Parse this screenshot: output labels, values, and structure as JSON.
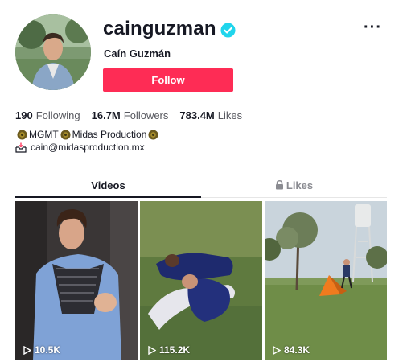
{
  "profile": {
    "username": "cainguzman",
    "display_name": "Caín Guzmán",
    "verified": true,
    "follow_label": "Follow",
    "more_label": "···"
  },
  "stats": [
    {
      "value": "190",
      "label": "Following"
    },
    {
      "value": "16.7M",
      "label": "Followers"
    },
    {
      "value": "783.4M",
      "label": "Likes"
    }
  ],
  "bio": {
    "segments": [
      "MGMT",
      "Midas Production"
    ],
    "email": "cain@midasproduction.mx"
  },
  "tabs": {
    "videos": "Videos",
    "likes": "Likes",
    "active": "videos"
  },
  "videos": [
    {
      "views": "10.5K"
    },
    {
      "views": "115.2K"
    },
    {
      "views": "84.3K"
    }
  ],
  "colors": {
    "accent": "#fe2c55",
    "verified": "#20d5ec",
    "text": "#161823",
    "muted": "#8a8b91"
  }
}
